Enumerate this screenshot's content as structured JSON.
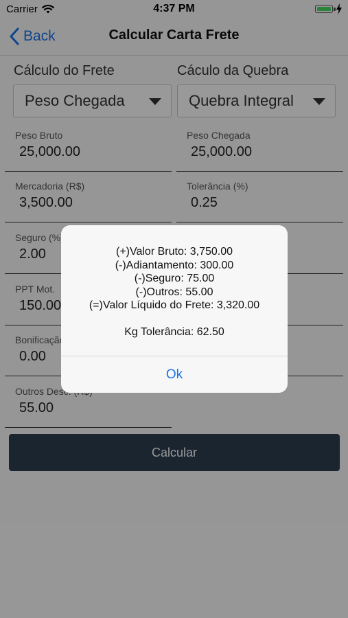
{
  "status_bar": {
    "carrier": "Carrier",
    "time": "4:37 PM"
  },
  "nav": {
    "back_label": "Back",
    "title": "Calcular Carta Frete"
  },
  "form": {
    "frete_label": "Cálculo do Frete",
    "frete_select": "Peso Chegada",
    "quebra_label": "Cáculo da Quebra",
    "quebra_select": "Quebra Integral",
    "fields": {
      "peso_bruto": {
        "label": "Peso Bruto",
        "value": "25,000.00"
      },
      "peso_chegada": {
        "label": "Peso Chegada",
        "value": "25,000.00"
      },
      "mercadoria": {
        "label": "Mercadoria (R$)",
        "value": "3,500.00"
      },
      "tolerancia": {
        "label": "Tolerância (%)",
        "value": "0.25"
      },
      "seguro": {
        "label": "Seguro (%)",
        "value": "2.00"
      },
      "ppt_mot": {
        "label": "PPT Mot.",
        "value": "150.00"
      },
      "bonificacao": {
        "label": "Bonificação",
        "value": "0.00"
      },
      "outros_desc": {
        "label": "Outros Desc. (R$)",
        "value": "55.00"
      }
    },
    "calc_button": "Calcular"
  },
  "alert": {
    "lines": [
      "(+)Valor Bruto: 3,750.00",
      "(-)Adiantamento: 300.00",
      "(-)Seguro: 75.00",
      "(-)Outros: 55.00",
      "(=)Valor Líquido do Frete: 3,320.00"
    ],
    "tolerance_line": "Kg Tolerância: 62.50",
    "ok_label": "Ok"
  }
}
